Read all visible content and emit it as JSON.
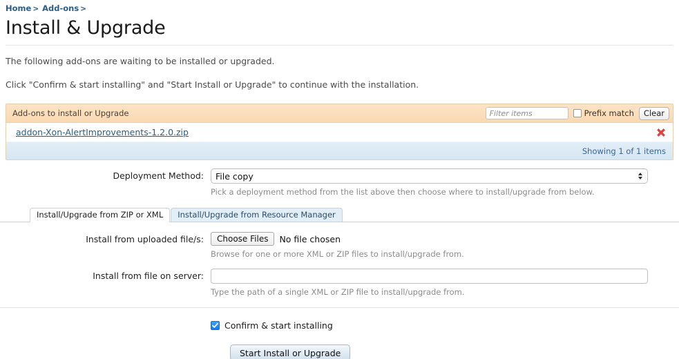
{
  "breadcrumb": {
    "items": [
      {
        "label": "Home",
        "separator": ">"
      },
      {
        "label": "Add-ons",
        "separator": ">"
      }
    ]
  },
  "page": {
    "title": "Install & Upgrade",
    "intro_line1": "The following add-ons are waiting to be installed or upgraded.",
    "intro_line2": "Click \"Confirm & start installing\" and \"Start Install or Upgrade\" to continue with the installation."
  },
  "addons_panel": {
    "header_title": "Add-ons to install or Upgrade",
    "filter_placeholder": "Filter items",
    "filter_value": "",
    "prefix_match_label": "Prefix match",
    "prefix_match_checked": false,
    "clear_label": "Clear",
    "rows": [
      {
        "name": "addon-Xon-AlertImprovements-1.2.0.zip",
        "delete_icon": "red-x-icon"
      }
    ],
    "footer_text": "Showing 1 of 1 items"
  },
  "deployment": {
    "label": "Deployment Method:",
    "selected": "File copy",
    "options": [
      "File copy"
    ],
    "hint": "Pick a deployment method from the list above then choose where to install/upgrade from below."
  },
  "tabs": [
    {
      "label": "Install/Upgrade from ZIP or XML",
      "active": true
    },
    {
      "label": "Install/Upgrade from Resource Manager",
      "active": false
    }
  ],
  "upload_row": {
    "label": "Install from uploaded file/s:",
    "choose_button": "Choose Files",
    "file_status": "No file chosen",
    "hint": "Browse for one or more XML or ZIP files to install/upgrade from."
  },
  "server_row": {
    "label": "Install from file on server:",
    "value": "",
    "placeholder": "",
    "hint": "Type the path of a single XML or ZIP file to install/upgrade from."
  },
  "confirm": {
    "label": "Confirm & start installing",
    "checked": true
  },
  "submit": {
    "label": "Start Install or Upgrade"
  },
  "colors": {
    "link": "#2b5d86",
    "panel_header_bg": "#fbdfbf",
    "panel_footer_bg": "#ddeaf5",
    "delete_icon": "#e8423f",
    "checkbox_accent": "#1a8cff"
  }
}
